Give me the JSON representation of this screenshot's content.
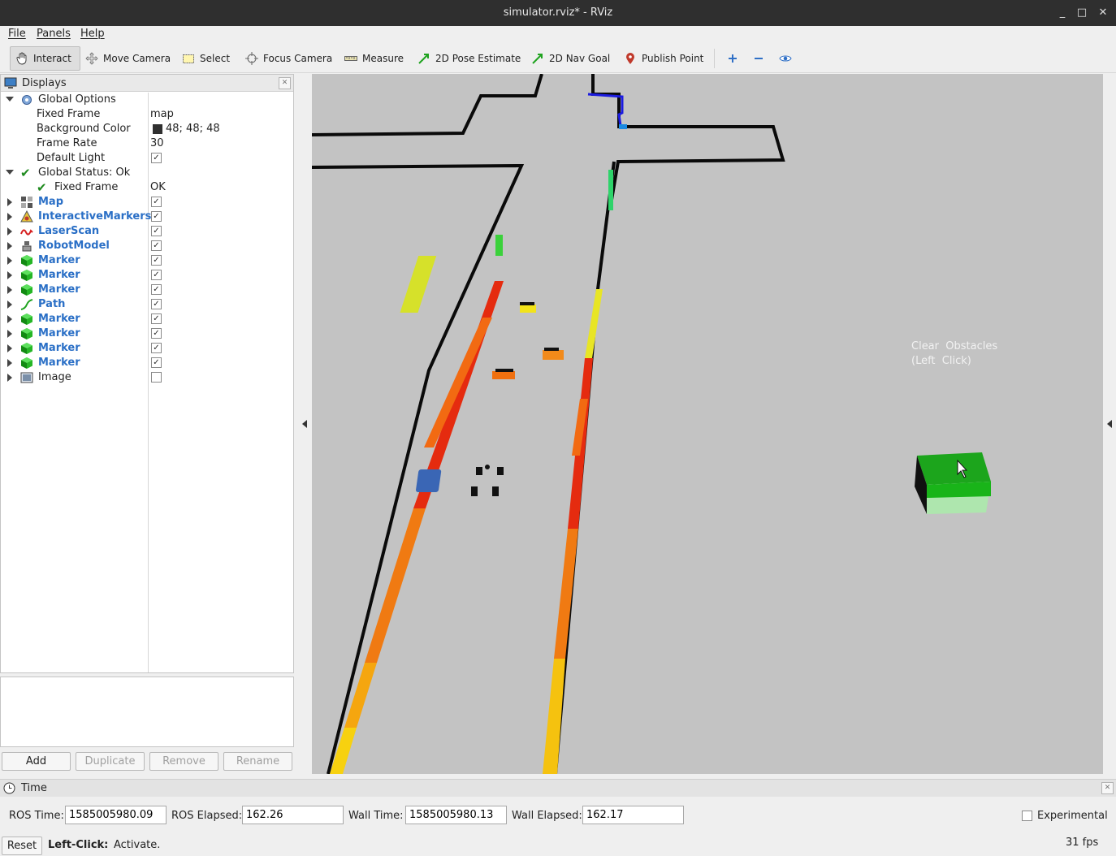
{
  "window": {
    "title": "simulator.rviz* - RViz",
    "controls": [
      "_",
      "□",
      "✕"
    ]
  },
  "menus": [
    "File",
    "Panels",
    "Help"
  ],
  "toolbar": {
    "tools": [
      {
        "label": "Interact",
        "icon": "hand-icon",
        "active": true
      },
      {
        "label": "Move Camera",
        "icon": "move-camera-icon"
      },
      {
        "label": "Select",
        "icon": "select-icon"
      },
      {
        "label": "Focus Camera",
        "icon": "focus-camera-icon"
      },
      {
        "label": "Measure",
        "icon": "ruler-icon"
      },
      {
        "label": "2D Pose Estimate",
        "icon": "green-arrow-icon"
      },
      {
        "label": "2D Nav Goal",
        "icon": "green-arrow-icon"
      },
      {
        "label": "Publish Point",
        "icon": "map-pin-icon"
      }
    ]
  },
  "displays": {
    "title": "Displays",
    "global_options": {
      "label": "Global Options",
      "fixed_frame_label": "Fixed Frame",
      "fixed_frame_value": "map",
      "background_color_label": "Background Color",
      "background_color_value": "48; 48; 48",
      "background_color_hex": "#303030",
      "frame_rate_label": "Frame Rate",
      "frame_rate_value": "30",
      "default_light_label": "Default Light",
      "default_light_checked": true
    },
    "global_status": {
      "label": "Global Status: Ok",
      "fixed_frame_label": "Fixed Frame",
      "fixed_frame_value": "OK"
    },
    "items": [
      {
        "name": "Map",
        "icon": "map-icon",
        "checked": true
      },
      {
        "name": "InteractiveMarkers",
        "icon": "interactive-markers-icon",
        "checked": true
      },
      {
        "name": "LaserScan",
        "icon": "laser-scan-icon",
        "checked": true
      },
      {
        "name": "RobotModel",
        "icon": "robot-model-icon",
        "checked": true
      },
      {
        "name": "Marker",
        "icon": "marker-cube-icon",
        "checked": true
      },
      {
        "name": "Marker",
        "icon": "marker-cube-icon",
        "checked": true
      },
      {
        "name": "Marker",
        "icon": "marker-cube-icon",
        "checked": true
      },
      {
        "name": "Path",
        "icon": "path-icon",
        "checked": true
      },
      {
        "name": "Marker",
        "icon": "marker-cube-icon",
        "checked": true
      },
      {
        "name": "Marker",
        "icon": "marker-cube-icon",
        "checked": true
      },
      {
        "name": "Marker",
        "icon": "marker-cube-icon",
        "checked": true
      },
      {
        "name": "Marker",
        "icon": "marker-cube-icon",
        "checked": true
      },
      {
        "name": "Image",
        "icon": "image-icon",
        "checked": false,
        "plain": true
      }
    ],
    "buttons": {
      "add": "Add",
      "duplicate": "Duplicate",
      "remove": "Remove",
      "rename": "Rename"
    }
  },
  "viewport": {
    "overlay_line1": "Clear  Obstacles",
    "overlay_line2": "(Left  Click)"
  },
  "time": {
    "title": "Time",
    "ros_time_label": "ROS Time:",
    "ros_time_value": "1585005980.09",
    "ros_elapsed_label": "ROS Elapsed:",
    "ros_elapsed_value": "162.26",
    "wall_time_label": "Wall Time:",
    "wall_time_value": "1585005980.13",
    "wall_elapsed_label": "Wall Elapsed:",
    "wall_elapsed_value": "162.17",
    "experimental_label": "Experimental"
  },
  "status": {
    "reset_label": "Reset",
    "hint_bold": "Left-Click:",
    "hint_text": "Activate.",
    "fps": "31 fps"
  }
}
